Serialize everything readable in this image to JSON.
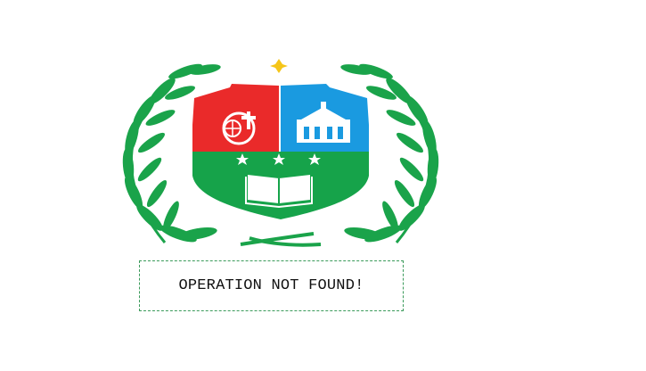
{
  "emblem": {
    "name": "school-crest-logo",
    "colors": {
      "red": "#ea2a2a",
      "blue": "#1a9ae0",
      "green": "#16a34a",
      "leaf": "#1aa34a",
      "star": "#f5c518",
      "white": "#ffffff"
    }
  },
  "message": {
    "text": "OPERATION NOT FOUND!"
  }
}
